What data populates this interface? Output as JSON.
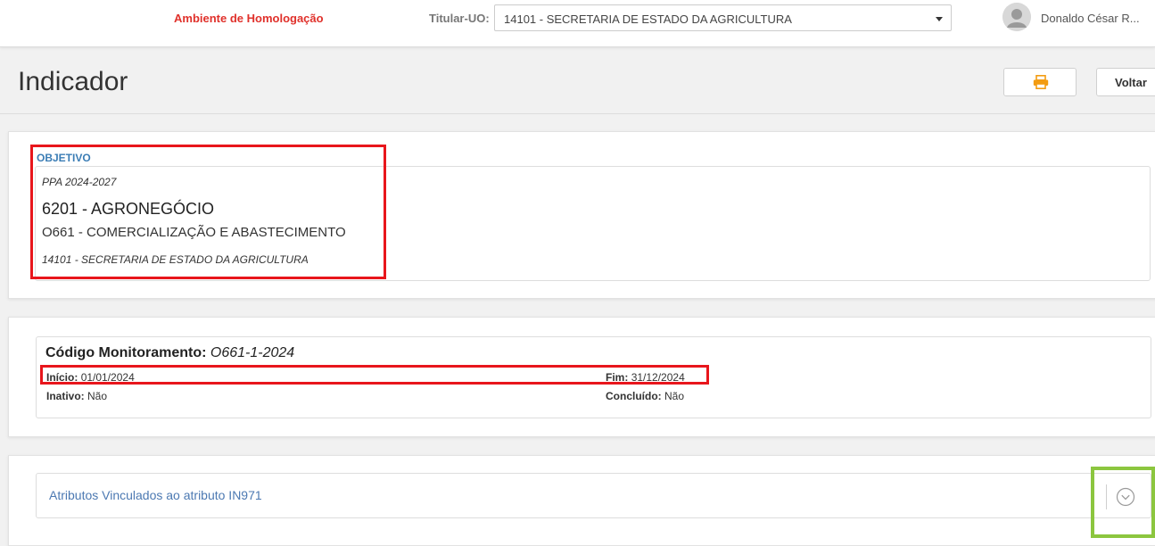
{
  "topbar": {
    "environment": "Ambiente de Homologação",
    "uo_label": "Titular-UO:",
    "uo_selected": "14101 - SECRETARIA DE ESTADO DA AGRICULTURA",
    "user_name": "Donaldo César R..."
  },
  "header": {
    "title": "Indicador",
    "print_icon": "printer-icon",
    "back_label": "Voltar"
  },
  "objetivo": {
    "section_label": "OBJETIVO",
    "ppa": "PPA 2024-2027",
    "program": "6201 - AGRONEGÓCIO",
    "objective": "O661 - COMERCIALIZAÇÃO E ABASTECIMENTO",
    "uo": "14101 - SECRETARIA DE ESTADO DA AGRICULTURA"
  },
  "monitoramento": {
    "codigo_label": "Código Monitoramento:",
    "codigo_value": "O661-1-2024",
    "inicio_label": "Início:",
    "inicio_value": "01/01/2024",
    "fim_label": "Fim:",
    "fim_value": "31/12/2024",
    "inativo_label": "Inativo:",
    "inativo_value": "Não",
    "concluido_label": "Concluído:",
    "concluido_value": "Não"
  },
  "atributos": {
    "title": "Atributos Vinculados ao atributo IN971",
    "toggle_icon": "chevron-down-circle-icon"
  },
  "colors": {
    "environment": "#e0312b",
    "section_label": "#3b7db5",
    "link": "#4c79b2",
    "print_icon": "#f39c12",
    "highlight_red": "#e8161c",
    "highlight_green": "#8cc63f"
  }
}
